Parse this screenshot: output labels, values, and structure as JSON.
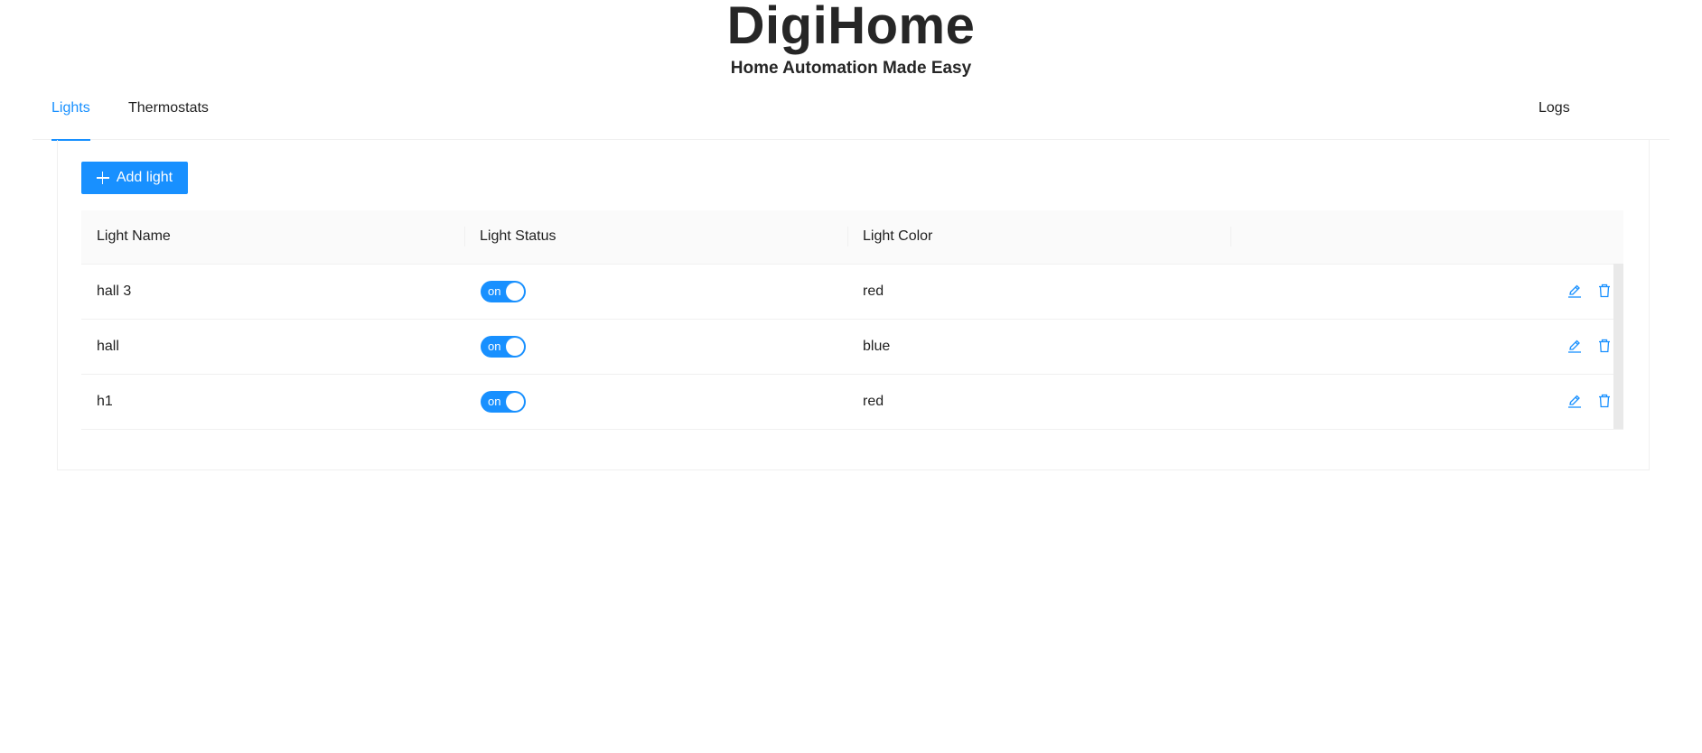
{
  "header": {
    "title": "DigiHome",
    "subtitle": "Home Automation Made Easy"
  },
  "tabs": [
    {
      "label": "Lights",
      "active": true
    },
    {
      "label": "Thermostats",
      "active": false
    },
    {
      "label": "Logs",
      "active": false
    }
  ],
  "toolbar": {
    "add_label": "Add light",
    "add_icon": "plus-icon"
  },
  "table": {
    "columns": [
      "Light Name",
      "Light Status",
      "Light Color",
      ""
    ],
    "rows": [
      {
        "name": "hall 3",
        "status": "on",
        "color": "red"
      },
      {
        "name": "hall",
        "status": "on",
        "color": "blue"
      },
      {
        "name": "h1",
        "status": "on",
        "color": "red"
      }
    ],
    "row_actions": [
      "edit-icon",
      "delete-icon"
    ]
  },
  "colors": {
    "accent": "#1890ff",
    "header_bg": "#fafafa",
    "border": "#f0f0f0",
    "text": "#262626"
  }
}
